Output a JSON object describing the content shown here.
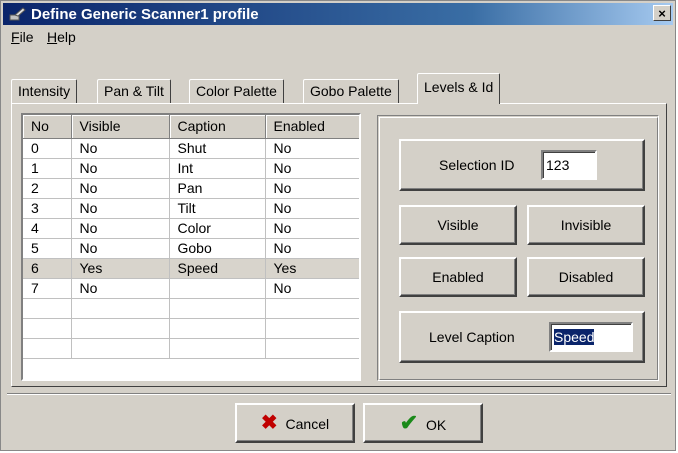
{
  "window": {
    "title": "Define Generic Scanner1 profile",
    "close_glyph": "×"
  },
  "menu": {
    "file": {
      "underline": "F",
      "rest": "ile"
    },
    "help": {
      "underline": "H",
      "rest": "elp"
    }
  },
  "tabs": [
    {
      "label": "Intensity",
      "active": false
    },
    {
      "label": "Pan & Tilt",
      "active": false
    },
    {
      "label": "Color Palette",
      "active": false
    },
    {
      "label": "Gobo Palette",
      "active": false
    },
    {
      "label": "Levels & Id",
      "active": true
    }
  ],
  "grid": {
    "columns": [
      "No",
      "Visible",
      "Caption",
      "Enabled"
    ],
    "rows": [
      [
        "0",
        "No",
        "Shut",
        "No"
      ],
      [
        "1",
        "No",
        "Int",
        "No"
      ],
      [
        "2",
        "No",
        "Pan",
        "No"
      ],
      [
        "3",
        "No",
        "Tilt",
        "No"
      ],
      [
        "4",
        "No",
        "Color",
        "No"
      ],
      [
        "5",
        "No",
        "Gobo",
        "No"
      ],
      [
        "6",
        "Yes",
        "Speed",
        "Yes"
      ],
      [
        "7",
        "No",
        "",
        "No"
      ]
    ],
    "selected_row": 6,
    "empty_rows": 3
  },
  "selection": {
    "label": "Selection ID",
    "value": "123"
  },
  "buttons": {
    "visible": "Visible",
    "invisible": "Invisible",
    "enabled": "Enabled",
    "disabled": "Disabled",
    "cancel": "Cancel",
    "ok": "OK"
  },
  "level_caption": {
    "label": "Level Caption",
    "value": "Speed"
  },
  "icons": {
    "cancel": "x-icon",
    "ok": "check-icon"
  },
  "colors": {
    "titlebar": "#0a246a",
    "face": "#d4d0c8",
    "cancel_icon": "#c00000",
    "ok_icon": "#1a8a1a"
  }
}
